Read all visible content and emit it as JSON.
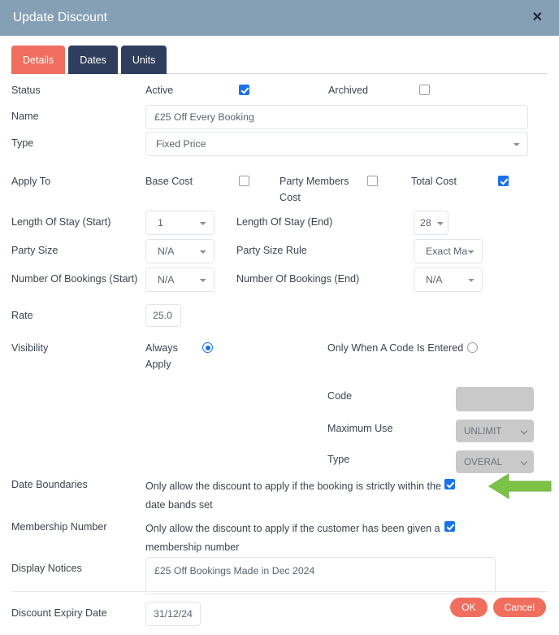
{
  "header": {
    "title": "Update Discount",
    "close_icon": "close-icon",
    "background_color": "#85a0b5"
  },
  "tabs": [
    {
      "label": "Details",
      "active": true,
      "color": "#ef6e5e"
    },
    {
      "label": "Dates",
      "active": false,
      "color": "#2e3e5c"
    },
    {
      "label": "Units",
      "active": false,
      "color": "#2e3e5c"
    }
  ],
  "form": {
    "status": {
      "label": "Status",
      "active_label": "Active",
      "active_checked": true,
      "archived_label": "Archived",
      "archived_checked": false
    },
    "name": {
      "label": "Name",
      "value": "£25 Off Every Booking"
    },
    "type": {
      "label": "Type",
      "value": "Fixed Price"
    },
    "apply_to": {
      "label": "Apply To",
      "base_cost_label": "Base Cost",
      "base_cost_checked": false,
      "party_members_cost_label": "Party Members Cost",
      "party_members_cost_checked": false,
      "total_cost_label": "Total Cost",
      "total_cost_checked": true
    },
    "length_of_stay_start": {
      "label": "Length Of Stay (Start)",
      "value": "1"
    },
    "length_of_stay_end": {
      "label": "Length Of Stay (End)",
      "value": "28"
    },
    "party_size": {
      "label": "Party Size",
      "value": "N/A"
    },
    "party_size_rule": {
      "label": "Party Size Rule",
      "value": "Exact Ma"
    },
    "number_of_bookings_start": {
      "label": "Number Of Bookings (Start)",
      "value": "N/A"
    },
    "number_of_bookings_end": {
      "label": "Number Of Bookings (End)",
      "value": "N/A"
    },
    "rate": {
      "label": "Rate",
      "value": "25.0"
    },
    "visibility": {
      "label": "Visibility",
      "always_apply_label": "Always Apply",
      "always_apply_selected": true,
      "only_code_label": "Only When A Code Is Entered",
      "only_code_selected": false,
      "code_label": "Code",
      "code_value": "",
      "maximum_use_label": "Maximum Use",
      "maximum_use_value": "UNLIMIT",
      "code_type_label": "Type",
      "code_type_value": "OVERAL"
    },
    "date_boundaries": {
      "label": "Date Boundaries",
      "description": "Only allow the discount to apply if the booking is strictly within the date bands set",
      "checked": true
    },
    "membership_number": {
      "label": "Membership Number",
      "description": "Only allow the discount to apply if the customer has been given a membership number",
      "checked": true
    },
    "display_notices": {
      "label": "Display Notices",
      "value": "£25 Off Bookings Made in Dec 2024"
    },
    "discount_expiry_date": {
      "label": "Discount Expiry Date",
      "value": "31/12/24"
    }
  },
  "footer": {
    "ok_label": "OK",
    "cancel_label": "Cancel",
    "button_color": "#ef6e5e"
  },
  "annotation": {
    "arrow_color": "#7cc247",
    "direction": "left"
  }
}
